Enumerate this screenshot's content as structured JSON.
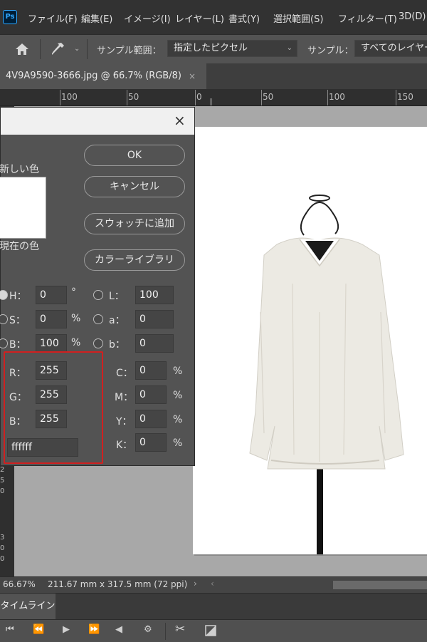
{
  "app": {
    "logo": "Ps"
  },
  "menu": [
    "ファイル(F)",
    "編集(E)",
    "イメージ(I)",
    "レイヤー(L)",
    "書式(Y)",
    "選択範囲(S)",
    "フィルター(T)",
    "3D(D)"
  ],
  "options": {
    "sample_range_label": "サンプル範囲：",
    "sample_range_value": "指定したピクセル",
    "sample_label": "サンプル：",
    "sample_value": "すべてのレイヤー"
  },
  "document": {
    "tab_label": "4V9A9590-3666.jpg @ 66.7% (RGB/8)",
    "close": "×"
  },
  "ruler": {
    "top_labels": [
      "100",
      "50",
      "0",
      "50",
      "100",
      "150"
    ],
    "left_labels": [
      "2",
      "5",
      "0",
      "3",
      "0",
      "0"
    ]
  },
  "status": {
    "zoom": "66.67%",
    "doc_size": "211.67 mm x 317.5 mm (72 ppi)"
  },
  "timeline": {
    "tab_label": "タイムライン"
  },
  "picker": {
    "new_label": "新しい色",
    "current_label": "現在の色",
    "close": "×",
    "buttons": {
      "ok": "OK",
      "cancel": "キャンセル",
      "add_swatch": "スウォッチに追加",
      "libraries": "カラーライブラリ"
    },
    "hsb": {
      "h_label": "H：",
      "h_value": "0",
      "h_unit": "°",
      "s_label": "S：",
      "s_value": "0",
      "s_unit": "%",
      "b_label": "B：",
      "b_value": "100",
      "b_unit": "%"
    },
    "lab": {
      "l_label": "L：",
      "l_value": "100",
      "a_label": "a：",
      "a_value": "0",
      "b_label": "b：",
      "b_value": "0"
    },
    "rgb": {
      "r_label": "R：",
      "r_value": "255",
      "g_label": "G：",
      "g_value": "255",
      "b_label": "B：",
      "b_value": "255"
    },
    "hex_value": "ffffff",
    "cmyk": {
      "c_label": "C：",
      "c_value": "0",
      "m_label": "M：",
      "m_value": "0",
      "y_label": "Y：",
      "y_value": "0",
      "k_label": "K：",
      "k_value": "0",
      "unit": "%"
    }
  }
}
